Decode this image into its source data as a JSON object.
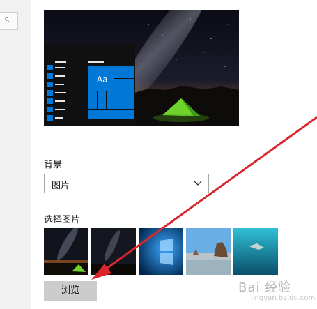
{
  "search": {
    "icon": "search-icon"
  },
  "preview": {
    "tile_label": "Aa"
  },
  "background": {
    "label": "背景",
    "selected": "图片"
  },
  "pictures": {
    "label": "选择图片",
    "thumbnails": [
      "night-sky-tent",
      "night-sky",
      "windows-10-blue",
      "beach-rocks",
      "underwater-swimmer"
    ]
  },
  "browse_button": "浏览",
  "watermark": {
    "text": "Bai 经验",
    "sub": "jingyan.baidu.com"
  },
  "colors": {
    "accent": "#0078d7",
    "arrow": "#d9262c",
    "tent": "#6fd32b"
  }
}
